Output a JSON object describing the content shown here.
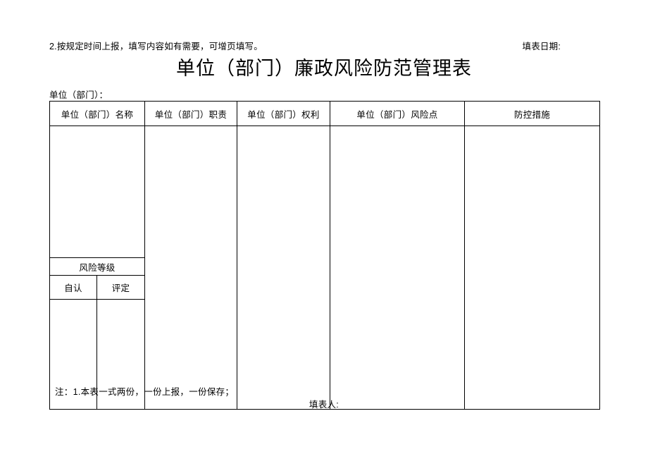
{
  "document": {
    "instruction_note": "2.按规定时间上报，填写内容如有需要，可增页填写。",
    "fill_date_label": "填表日期:",
    "title": "单位（部门）廉政风险防范管理表",
    "unit_label": "单位（部门）："
  },
  "table": {
    "headers": [
      "单位（部门）名称",
      "单位（部门）职责",
      "单位（部门）权利",
      "单位（部门）风险点",
      "防控措施"
    ],
    "risk_level": {
      "group_label": "风险等级",
      "sub_headers": [
        "自认",
        "评定"
      ]
    },
    "body_rows": [
      {
        "name": "",
        "duty": "",
        "power": "",
        "risk_point": "",
        "control_measure": "",
        "self_assessment": "",
        "evaluation": ""
      }
    ]
  },
  "footer": {
    "note": "注：1.本表一式两份，一份上报，一份保存；",
    "signer_label": "填表人:"
  }
}
